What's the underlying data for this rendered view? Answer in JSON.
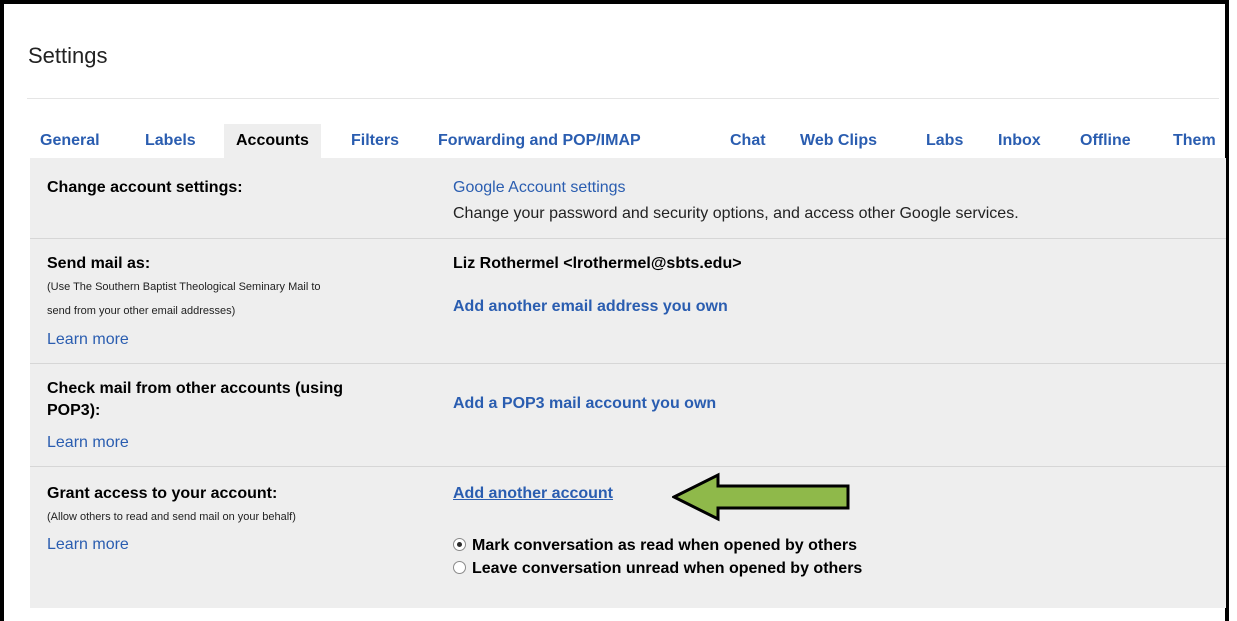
{
  "page": {
    "title": "Settings"
  },
  "tabs": [
    {
      "label": "General"
    },
    {
      "label": "Labels"
    },
    {
      "label": "Accounts"
    },
    {
      "label": "Filters"
    },
    {
      "label": "Forwarding and POP/IMAP"
    },
    {
      "label": "Chat"
    },
    {
      "label": "Web Clips"
    },
    {
      "label": "Labs"
    },
    {
      "label": "Inbox"
    },
    {
      "label": "Offline"
    },
    {
      "label": "Them"
    }
  ],
  "active_tab": "Accounts",
  "sections": {
    "change_account": {
      "label": "Change account settings:",
      "link": "Google Account settings",
      "description": "Change your password and security options, and access other Google services."
    },
    "send_mail": {
      "label": "Send mail as:",
      "note": "(Use The Southern Baptist Theological Seminary Mail to send from your other email addresses)",
      "note_line1": "(Use The Southern Baptist Theological Seminary Mail to",
      "note_line2": "send from your other email addresses)",
      "learn_more": "Learn more",
      "address": "Liz Rothermel <lrothermel@sbts.edu>",
      "add_link": "Add another email address you own"
    },
    "check_mail": {
      "label_line1": "Check mail from other accounts (using",
      "label_line2": "POP3):",
      "learn_more": "Learn more",
      "add_link": "Add a POP3 mail account you own"
    },
    "grant_access": {
      "label": "Grant access to your account:",
      "note": "(Allow others to read and send mail on your behalf)",
      "learn_more": "Learn more",
      "add_link": "Add another account",
      "radio_options": [
        {
          "label": "Mark conversation as read when opened by others",
          "selected": true
        },
        {
          "label": "Leave conversation unread when opened by others",
          "selected": false
        }
      ]
    }
  },
  "colors": {
    "link": "#2a5db0",
    "panel": "#eeeeee",
    "arrow_fill": "#8fb94a"
  },
  "icons": {
    "arrow": "left-arrow-icon"
  }
}
